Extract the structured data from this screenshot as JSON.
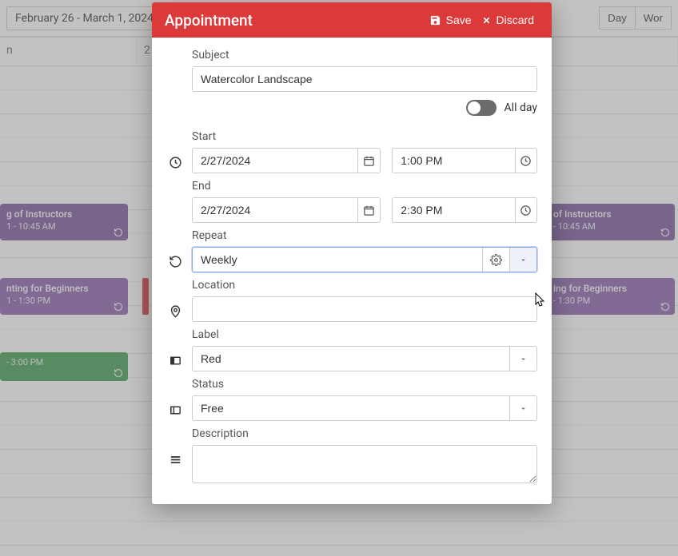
{
  "toolbar": {
    "date_range": "February 26 - March 1, 2024",
    "view_day": "Day",
    "view_work": "Wor"
  },
  "day_headers": [
    "n",
    "2"
  ],
  "events": {
    "left1": {
      "title": "g of Instructors",
      "time": "1 - 10:45 AM"
    },
    "left2": {
      "title": "nting for Beginners",
      "time": "1 - 1:30 PM"
    },
    "left3": {
      "title": " - 3:00 PM"
    },
    "right1": {
      "title": " of Instructors",
      "time": " - 10:45 AM"
    },
    "right2": {
      "title": "ing for Beginners",
      "time": " - 1:30 PM"
    }
  },
  "modal": {
    "title": "Appointment",
    "save": "Save",
    "discard": "Discard",
    "subject_label": "Subject",
    "subject_value": "Watercolor Landscape",
    "allday_label": "All day",
    "start_label": "Start",
    "start_date": "2/27/2024",
    "start_time": "1:00 PM",
    "end_label": "End",
    "end_date": "2/27/2024",
    "end_time": "2:30 PM",
    "repeat_label": "Repeat",
    "repeat_value": "Weekly",
    "location_label": "Location",
    "location_value": "",
    "label_label": "Label",
    "label_value": "Red",
    "status_label": "Status",
    "status_value": "Free",
    "description_label": "Description",
    "description_value": ""
  }
}
